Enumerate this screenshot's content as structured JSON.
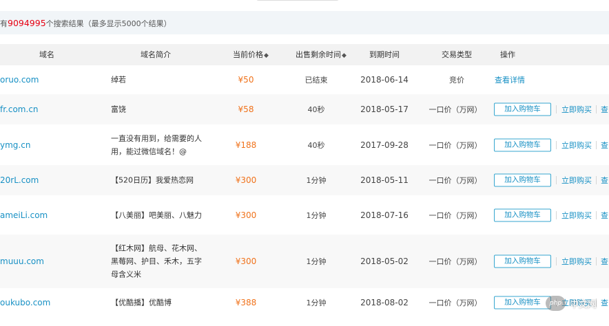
{
  "summary": {
    "prefix": "有",
    "count": "9094995",
    "suffix": "个搜索结果（最多显示5000个结果）"
  },
  "columns": {
    "domain": "域名",
    "intro": "域名简介",
    "price": "当前价格",
    "remaining": "出售剩余时间",
    "expire": "到期时间",
    "type": "交易类型",
    "action": "操作",
    "sort_icon": "◆"
  },
  "rows": [
    {
      "domain": "oruo.com",
      "intro": "绰若",
      "price": "¥50",
      "remaining": "已结束",
      "expire": "2018-06-14",
      "type": "竞价",
      "detail": "查看详情"
    },
    {
      "domain": "fr.com.cn",
      "intro": "富饶",
      "price": "¥58",
      "remaining": "40秒",
      "expire": "2018-05-17",
      "type": "一口价（万网）",
      "cart": "加入购物车",
      "buy": "立即购买",
      "more": "查"
    },
    {
      "domain": "ymg.cn",
      "intro": "一直没有用到，给需要的人用，能过微信域名！@",
      "price": "¥188",
      "remaining": "40秒",
      "expire": "2017-09-28",
      "type": "一口价（万网）",
      "cart": "加入购物车",
      "buy": "立即购买",
      "more": "查"
    },
    {
      "domain": "20rL.com",
      "intro": "【520日历】我爱热恋网",
      "price": "¥300",
      "remaining": "1分钟",
      "expire": "2018-05-11",
      "type": "一口价（万网）",
      "cart": "加入购物车",
      "buy": "立即购买",
      "more": "查"
    },
    {
      "domain": "ameiLi.com",
      "intro": "【八美丽】吧美丽、八魅力",
      "price": "¥300",
      "remaining": "1分钟",
      "expire": "2018-07-16",
      "type": "一口价（万网）",
      "cart": "加入购物车",
      "buy": "立即购买",
      "more": "查"
    },
    {
      "domain": "muuu.com",
      "intro": "【红木网】航母、花木网、黑莓网、护目、禾木，五字母含义米",
      "price": "¥300",
      "remaining": "1分钟",
      "expire": "2018-05-02",
      "type": "一口价（万网）",
      "cart": "加入购物车",
      "buy": "立即购买",
      "more": "查"
    },
    {
      "domain": "oukubo.com",
      "intro": "【优酷播】优酷博",
      "price": "¥388",
      "remaining": "1分钟",
      "expire": "2018-08-02",
      "type": "一口价（万网）",
      "cart": "加入购物车",
      "buy": "立即购买",
      "more": "查"
    }
  ],
  "watermark": {
    "logo": "php",
    "text": "中文网"
  }
}
